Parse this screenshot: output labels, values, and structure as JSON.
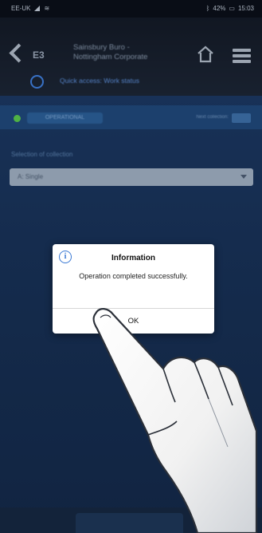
{
  "status_bar": {
    "carrier": "EE-UK",
    "battery": "42%",
    "time": "15:03"
  },
  "header": {
    "back_code": "E3",
    "site_name_line1": "Sainsbury Buro -",
    "site_name_line2": "Nottingham Corporate",
    "subtitle": "Quick access: Work status"
  },
  "content": {
    "status_label": "OPERATIONAL",
    "status_right": "Next collection: ",
    "section_label": "Selection of collection",
    "dropdown_value": "A: Single",
    "status_color": "#56c24a"
  },
  "dialog": {
    "icon": "info-icon",
    "title": "Information",
    "message": "Operation completed successfully.",
    "ok_label": "OK"
  },
  "colors": {
    "accent": "#3a79d4",
    "header_bg": "#131a26",
    "content_bg": "#1d3a66"
  }
}
